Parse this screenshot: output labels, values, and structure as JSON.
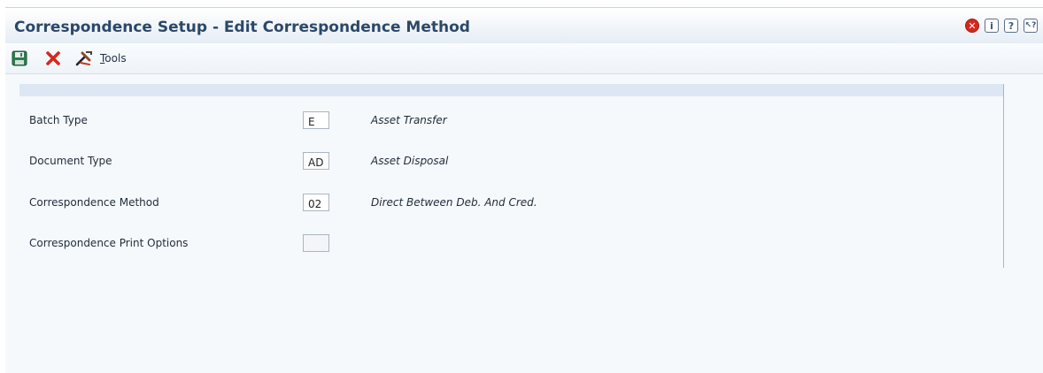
{
  "window": {
    "title": "Correspondence Setup - Edit Correspondence Method",
    "title_icons": [
      "close-circle-icon",
      "info-icon",
      "help-icon",
      "context-help-icon"
    ]
  },
  "toolbar": {
    "save_icon": "save-icon",
    "cancel_icon": "cancel-x-icon",
    "tools_icon": "tools-icon",
    "tools_label": "ools",
    "tools_accel": "T"
  },
  "form": {
    "rows": [
      {
        "label": "Batch Type",
        "value": "E",
        "description": "Asset Transfer"
      },
      {
        "label": "Document Type",
        "value": "AD",
        "description": "Asset Disposal"
      },
      {
        "label": "Correspondence Method",
        "value": "02",
        "description": "Direct Between Deb. And Cred."
      },
      {
        "label": "Correspondence Print Options",
        "value": "",
        "description": ""
      }
    ]
  },
  "colors": {
    "title_text": "#2b4869",
    "panel_header": "#dce7f3",
    "close_red": "#d6281e",
    "save_green": "#2e7d4f"
  }
}
